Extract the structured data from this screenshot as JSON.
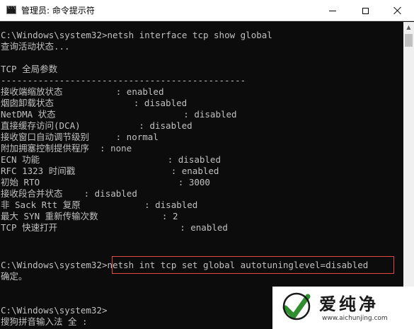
{
  "window": {
    "title": "管理员: 命令提示符"
  },
  "icons": {
    "app": "cmd-app-icon",
    "minimize": "minimize-icon",
    "maximize": "maximize-icon",
    "close": "close-icon"
  },
  "colors": {
    "console_bg": "#0c0c0c",
    "console_text": "#c0c0c0",
    "highlight_border": "#e0473c",
    "watermark_green": "#2f8f2f"
  },
  "console": {
    "lines": [
      "C:\\Windows\\system32>netsh interface tcp show global",
      "查询活动状态...",
      "",
      "TCP 全局参数",
      "----------------------------------------------",
      "接收端缩放状态          : enabled",
      "烟囱卸载状态               : disabled",
      "NetDMA 状态                        : disabled",
      "直接缓存访问(DCA)           : disabled",
      "接收窗口自动调节级别     : normal",
      "附加拥塞控制提供程序  : none",
      "ECN 功能                        : disabled",
      "RFC 1323 时间戳                  : enabled",
      "初始 RTO                          : 3000",
      "接收段合并状态    : disabled",
      "非 Sack Rtt 复原            : disabled",
      "最大 SYN 重新传输次数            : 2",
      "TCP 快速打开                       : enabled",
      "",
      "",
      "C:\\Windows\\system32>netsh int tcp set global autotuninglevel=disabled",
      "确定。",
      "",
      "",
      "C:\\Windows\\system32>",
      "搜狗拼音输入法 全 :"
    ]
  },
  "watermark": {
    "brand": "爱纯净",
    "url": "www.aichunjing.com",
    "logo_icon": "brand-logo-icon"
  }
}
